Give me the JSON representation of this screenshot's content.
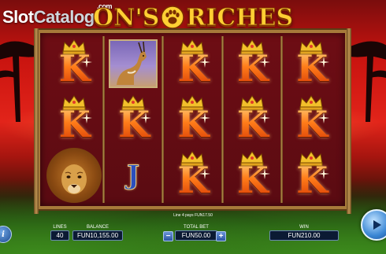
{
  "logo": {
    "slot": "Slot",
    "catalog": "Catalog",
    "com": ".com"
  },
  "game_title": {
    "part1": "ON'S",
    "part2": "RICHES"
  },
  "reels": [
    [
      "K",
      "K",
      "LION"
    ],
    [
      "GAZELLE",
      "K",
      "J"
    ],
    [
      "K",
      "K",
      "K"
    ],
    [
      "K",
      "K",
      "K"
    ],
    [
      "K",
      "K",
      "K"
    ]
  ],
  "info_text": "Line 4 pays FUN17.50",
  "controls": {
    "info_label": "i",
    "lines_label": "LINES",
    "lines_value": "40",
    "balance_label": "BALANCE",
    "balance_value": "FUN10,155.00",
    "minus_label": "−",
    "total_bet_label": "TOTAL BET",
    "total_bet_value": "FUN50.00",
    "plus_label": "+",
    "win_label": "WIN",
    "win_value": "FUN210.00"
  },
  "colors": {
    "sky": "#e2241a",
    "frame_wood": "#a77a3a",
    "reel_bg": "#6e0d14",
    "k_symbol": "#ff5a10",
    "crown": "#f3c02b",
    "ui_field": "#0b1a33",
    "spin_button": "#3a86d4"
  }
}
